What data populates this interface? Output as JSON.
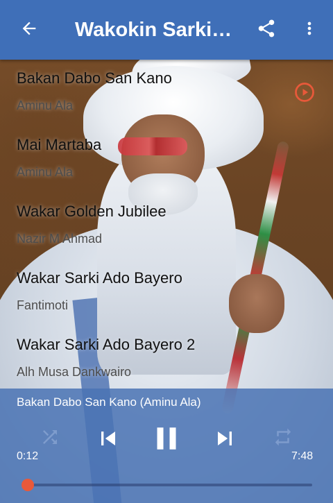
{
  "app": {
    "title": "Wakokin Sarkin Kano",
    "accent_color": "#3f6fb8",
    "highlight_color": "#e8593a"
  },
  "toolbar": {
    "back_icon": "arrow-left-icon",
    "share_icon": "share-icon",
    "more_icon": "more-vertical-icon"
  },
  "songs": [
    {
      "title": "Bakan Dabo San Kano",
      "artist": "Aminu Ala",
      "playing": true
    },
    {
      "title": "Mai Martaba",
      "artist": "Aminu Ala",
      "playing": false
    },
    {
      "title": "Wakar Golden Jubilee",
      "artist": "Nazir M Ahmad",
      "playing": false
    },
    {
      "title": "Wakar Sarki Ado Bayero",
      "artist": "Fantimoti",
      "playing": false
    },
    {
      "title": "Wakar Sarki Ado Bayero 2",
      "artist": "Alh Musa Dankwairo",
      "playing": false
    }
  ],
  "player": {
    "now_playing": "Bakan Dabo San Kano (Aminu Ala)",
    "elapsed": "0:12",
    "duration": "7:48",
    "progress": 0.0,
    "icons": {
      "shuffle": "shuffle-icon",
      "previous": "skip-previous-icon",
      "pause": "pause-icon",
      "next": "skip-next-icon",
      "repeat": "repeat-icon"
    }
  }
}
